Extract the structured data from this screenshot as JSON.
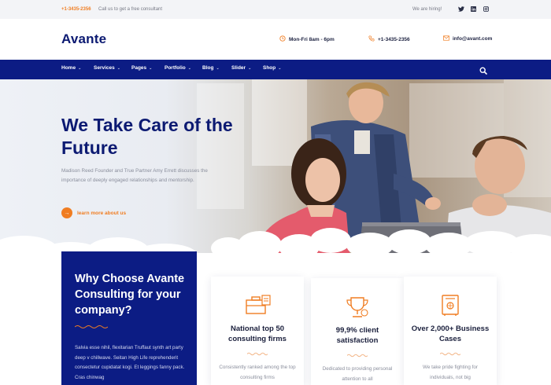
{
  "topbar": {
    "phone": "+1-3435-2356",
    "call_text": "Call us to get a free consultant",
    "hiring": "We are hiring!",
    "social_icons": [
      "twitter-icon",
      "linkedin-icon",
      "instagram-icon"
    ]
  },
  "header": {
    "logo": "Avante",
    "hours": "Mon-Fri 8am - 6pm",
    "phone": "+1-3435-2356",
    "email": "info@avant.com"
  },
  "nav": {
    "items": [
      "Home",
      "Services",
      "Pages",
      "Portfolio",
      "Blog",
      "Slider",
      "Shop"
    ]
  },
  "hero": {
    "title": "We Take Care of the Future",
    "description": "Madison Reed Founder and True Partner Amy Errett discusses the importance of deeply engaged relationships and mentorship.",
    "cta_label": "learn more about us"
  },
  "why": {
    "title": "Why Choose Avante Consulting for your company?",
    "text": "Salvia esse nihil, flexitarian Truffaut synth art party deep v chillwave. Seitan High Life reprehenderit consectetur cupidatat kogi. Et leggings fanny pack. Cras chinwag"
  },
  "cards": [
    {
      "title": "National top 50 consulting firms",
      "text": "Consistently ranked among the top consulting firms",
      "icon": "briefcase-icon"
    },
    {
      "title": "99,9% client satisfaction",
      "text": "Dedicated to providing personal attention to all",
      "icon": "trophy-icon"
    },
    {
      "title": "Over 2,000+ Business Cases",
      "text": "We take pride fighting for individuals, not big",
      "icon": "safe-icon"
    }
  ],
  "colors": {
    "brand_navy": "#0c1c84",
    "accent_orange": "#f07d22"
  }
}
